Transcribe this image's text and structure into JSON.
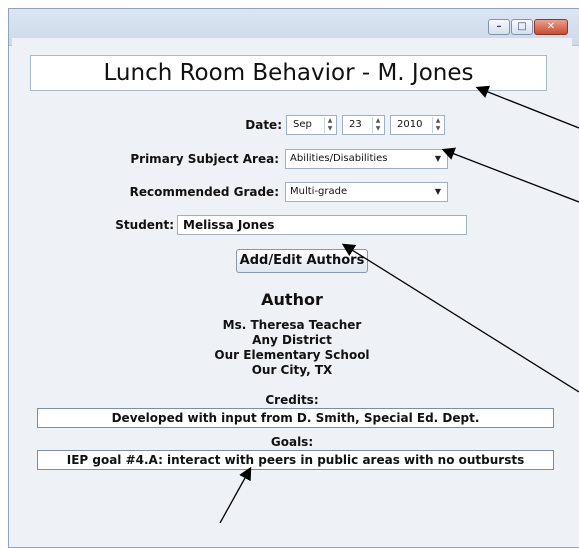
{
  "window": {
    "minimize_icon": "minimize-icon",
    "maximize_icon": "maximize-icon",
    "close_icon": "close-icon",
    "title_box_text": "Lunch Room Behavior - M. Jones"
  },
  "form": {
    "date_label": "Date:",
    "month": "Sep",
    "day": "23",
    "year": "2010",
    "subject_label": "Primary Subject Area:",
    "subject_value": "Abilities/Disabilities",
    "grade_label": "Recommended Grade:",
    "grade_value": "Multi-grade",
    "student_label": "Student:",
    "student_value": "Melissa Jones",
    "authors_button": "Add/Edit Authors"
  },
  "author": {
    "heading": "Author",
    "name": "Ms. Theresa Teacher",
    "district": "Any District",
    "school": "Our Elementary School",
    "city": "Our City, TX"
  },
  "credits": {
    "label": "Credits:",
    "value": "Developed with input from D. Smith, Special Ed. Dept."
  },
  "goals": {
    "label": "Goals:",
    "value": "IEP goal #4.A: interact with peers in public areas with no outbursts"
  }
}
